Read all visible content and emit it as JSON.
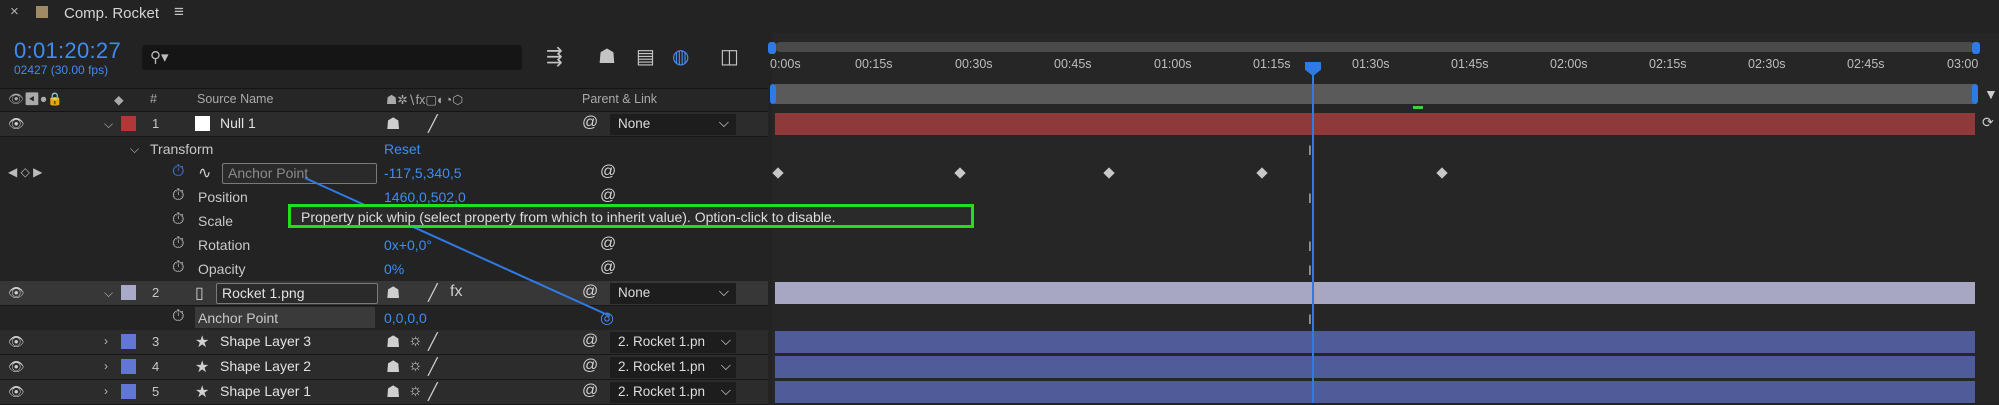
{
  "tab": {
    "close": "×",
    "title": "Comp. Rocket",
    "menu": "≡",
    "swatch_color": "#a08a66"
  },
  "time": {
    "code": "0:01:20:27",
    "frames": "02427 (30.00 fps)"
  },
  "search": {
    "placeholder": ""
  },
  "headers": {
    "num": "#",
    "source": "Source Name",
    "parent": "Parent & Link"
  },
  "timeline": {
    "ticks": [
      "0:00s",
      "00:15s",
      "00:30s",
      "00:45s",
      "01:00s",
      "01:15s",
      "01:30s",
      "01:45s",
      "02:00s",
      "02:15s",
      "02:30s",
      "02:45s",
      "03:00"
    ]
  },
  "layers": [
    {
      "num": "1",
      "name": "Null 1",
      "color": "#b03838",
      "parent": "None"
    },
    {
      "num": "2",
      "name": "Rocket 1.png",
      "color": "#a9a9c9",
      "parent": "None"
    },
    {
      "num": "3",
      "name": "Shape Layer 3",
      "color": "#6277d4",
      "parent": "2. Rocket 1.pn"
    },
    {
      "num": "4",
      "name": "Shape Layer 2",
      "color": "#6277d4",
      "parent": "2. Rocket 1.pn"
    },
    {
      "num": "5",
      "name": "Shape Layer 1",
      "color": "#6277d4",
      "parent": "2. Rocket 1.pn"
    }
  ],
  "transform": {
    "group": "Transform",
    "reset": "Reset",
    "props": [
      {
        "name": "Anchor Point",
        "value": "-117,5,340,5"
      },
      {
        "name": "Position",
        "value": "1460,0,502,0"
      },
      {
        "name": "Scale",
        "value": ""
      },
      {
        "name": "Rotation",
        "value": "0x+0,0°"
      },
      {
        "name": "Opacity",
        "value": "0%"
      }
    ]
  },
  "rocket_prop": {
    "name": "Anchor Point",
    "value": "0,0,0,0"
  },
  "tooltip": "Property pick whip (select property from which to inherit value). Option-click to disable."
}
